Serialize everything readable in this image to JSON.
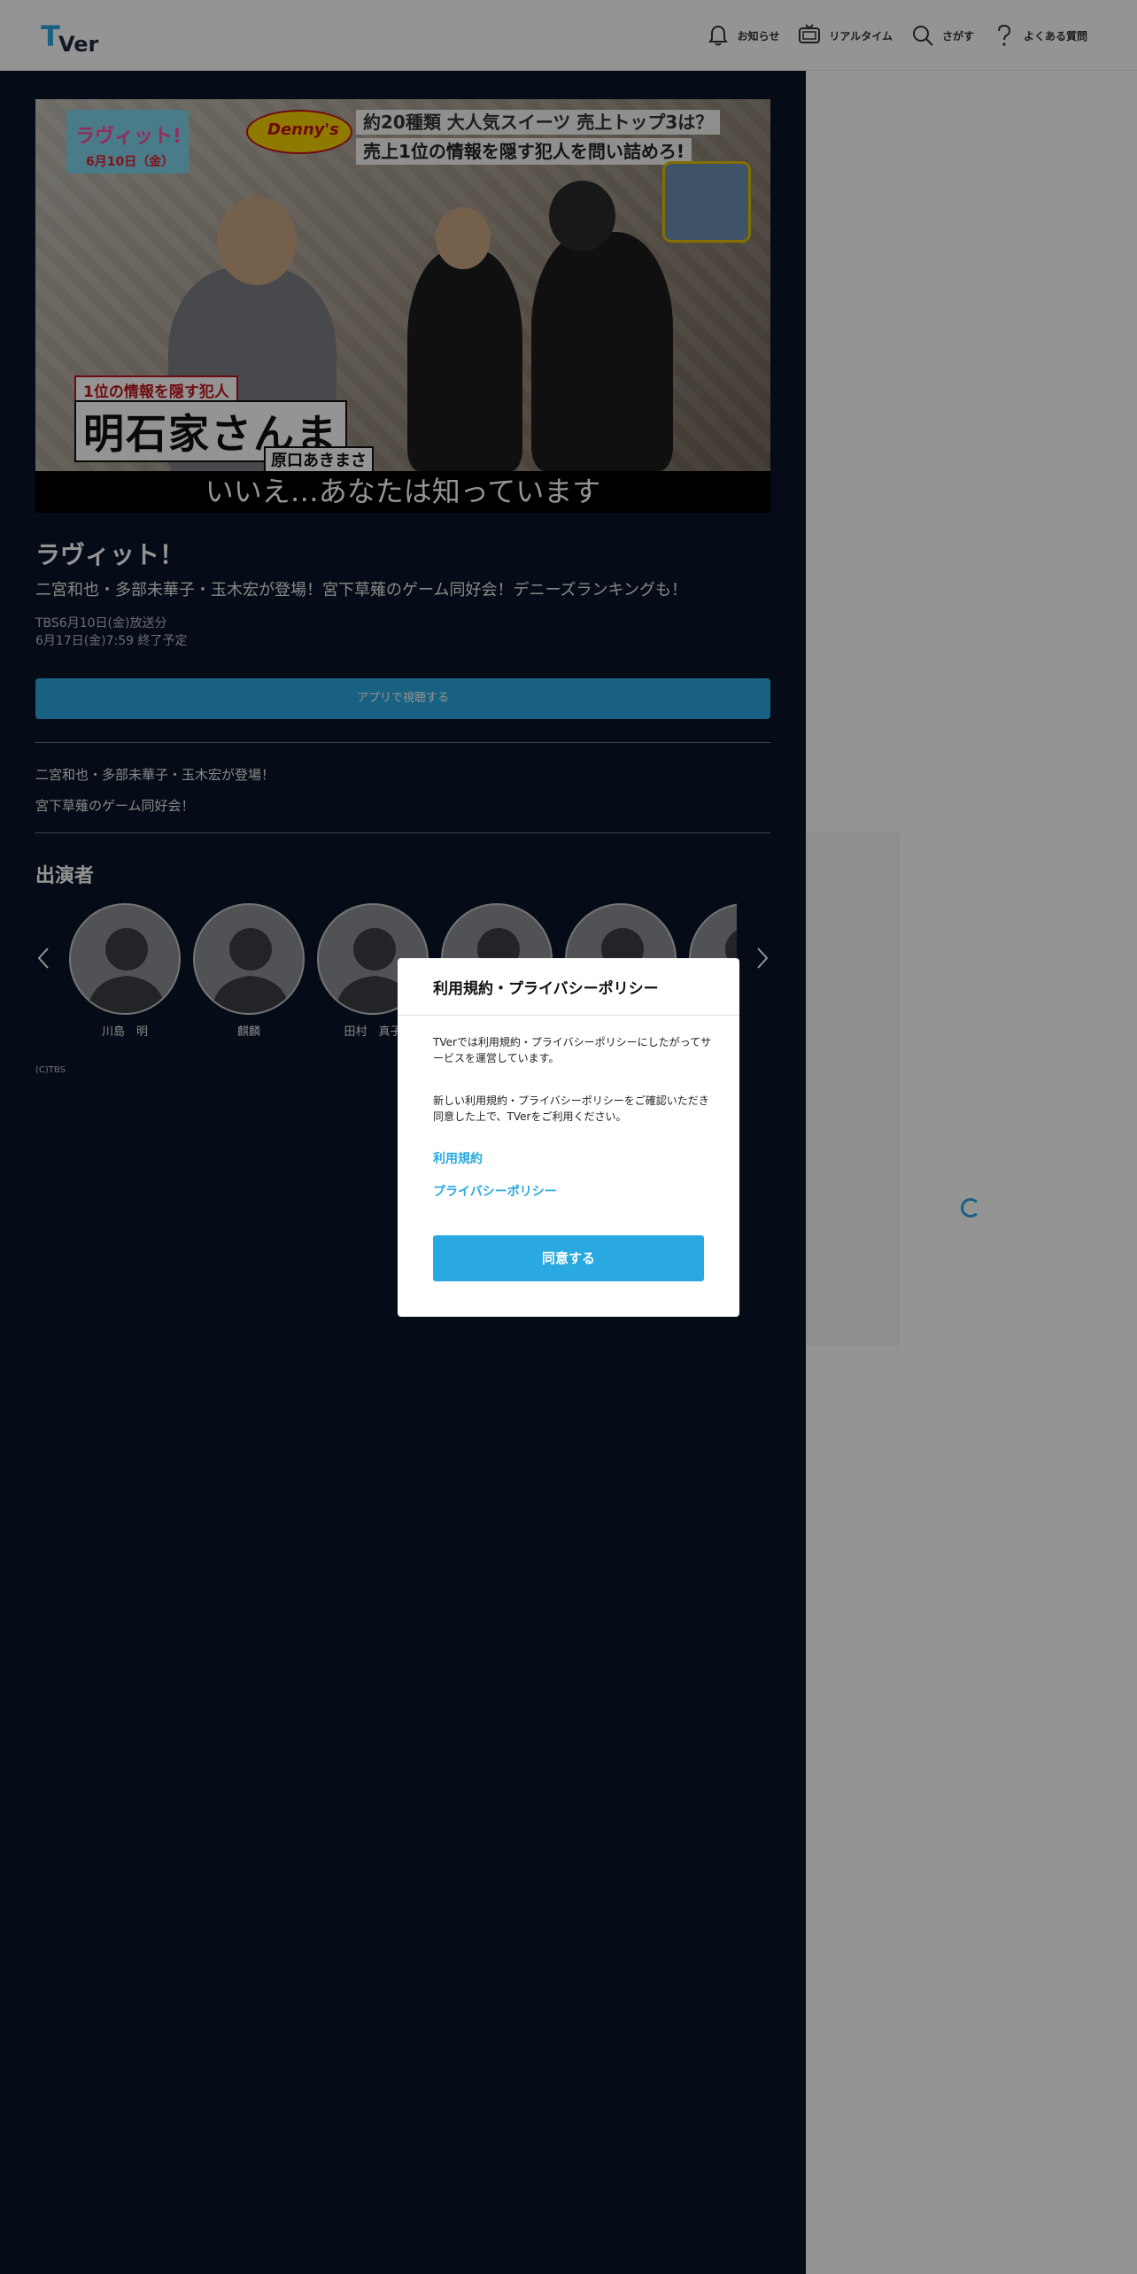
{
  "header": {
    "logo_text": "TVer",
    "nav": [
      {
        "label": "お知らせ",
        "icon": "bell-icon"
      },
      {
        "label": "リアルタイム",
        "icon": "tv-icon"
      },
      {
        "label": "さがす",
        "icon": "search-icon"
      },
      {
        "label": "よくある質問",
        "icon": "question-icon"
      }
    ]
  },
  "video": {
    "thumbnail": {
      "show_logo": "ラヴィット!",
      "show_date": "6月10日（金）",
      "sponsor_logo": "Denny's",
      "caption_line1": "約20種類 大人気スイーツ 売上トップ3は？",
      "caption_line2": "売上1位の情報を隠す犯人を問い詰めろ!",
      "tag": "1位の情報を隠す犯人",
      "name": "明石家さんま",
      "name_sub": "原口あきまさ",
      "subtitle": "いいえ…あなたは知っています"
    },
    "title": "ラヴィット！",
    "episode": "二宮和也・多部未華子・玉木宏が登場！宮下草薙のゲーム同好会！デニーズランキングも！",
    "broadcast": "TBS6月10日(金)放送分",
    "expire": "6月17日(金)7:59 終了予定",
    "watch_button": "アプリで視聴する",
    "description": [
      "二宮和也・多部未華子・玉木宏が登場！",
      "宮下草薙のゲーム同好会！"
    ]
  },
  "cast": {
    "heading": "出演者",
    "members": [
      {
        "name": "川島　明"
      },
      {
        "name": "麒麟"
      },
      {
        "name": "田村　真子"
      },
      {
        "name": ""
      },
      {
        "name": ""
      },
      {
        "name": ""
      }
    ]
  },
  "copyright": "(C)TBS",
  "modal": {
    "title": "利用規約・プライバシーポリシー",
    "text1": "TVerでは利用規約・プライバシーポリシーにしたがってサービスを運営しています。",
    "text2": "新しい利用規約・プライバシーポリシーをご確認いただき同意した上で、TVerをご利用ください。",
    "link_terms": "利用規約",
    "link_privacy": "プライバシーポリシー",
    "agree_button": "同意する"
  },
  "colors": {
    "accent": "#2aa8e0",
    "background": "#0a1628"
  }
}
